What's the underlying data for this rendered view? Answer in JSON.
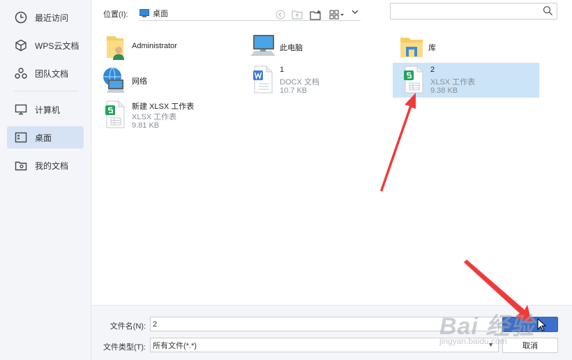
{
  "sidebar": {
    "items": [
      {
        "label": "最近访问",
        "icon": "clock-icon"
      },
      {
        "label": "WPS云文档",
        "icon": "cube-icon"
      },
      {
        "label": "团队文档",
        "icon": "team-icon"
      },
      {
        "label": "计算机",
        "icon": "monitor-icon"
      },
      {
        "label": "桌面",
        "icon": "desktop-icon",
        "active": true
      },
      {
        "label": "我的文档",
        "icon": "documents-icon"
      }
    ]
  },
  "toolbar": {
    "location_label": "位置(I):",
    "location_value": "桌面",
    "search_placeholder": ""
  },
  "files": [
    {
      "name": "Administrator",
      "icon": "user-folder-icon"
    },
    {
      "name": "此电脑",
      "icon": "computer-icon"
    },
    {
      "name": "库",
      "icon": "library-folder-icon"
    },
    {
      "name": "网络",
      "icon": "network-icon"
    },
    {
      "name": "1",
      "type": "DOCX 文档",
      "size": "10.7 KB",
      "icon": "docx-file-icon"
    },
    {
      "name": "2",
      "type": "XLSX 工作表",
      "size": "9.38 KB",
      "icon": "xlsx-file-icon",
      "selected": true
    },
    {
      "name": "新建 XLSX 工作表",
      "type": "XLSX 工作表",
      "size": "9.81 KB",
      "icon": "xlsx-file-icon"
    }
  ],
  "bottom": {
    "filename_label": "文件名(N):",
    "filename_value": "2",
    "filetype_label": "文件类型(T):",
    "filetype_value": "所有文件(*.*)",
    "open_label": "",
    "cancel_label": "取消"
  },
  "watermark": {
    "text": "Bai 经验",
    "sub": "jingyan.baidu.com"
  },
  "colors": {
    "accent": "#3d6fcc",
    "selection": "#cce4f7",
    "sidebar_active": "#d5e3f5",
    "annotation_arrow": "#f03a3a"
  }
}
